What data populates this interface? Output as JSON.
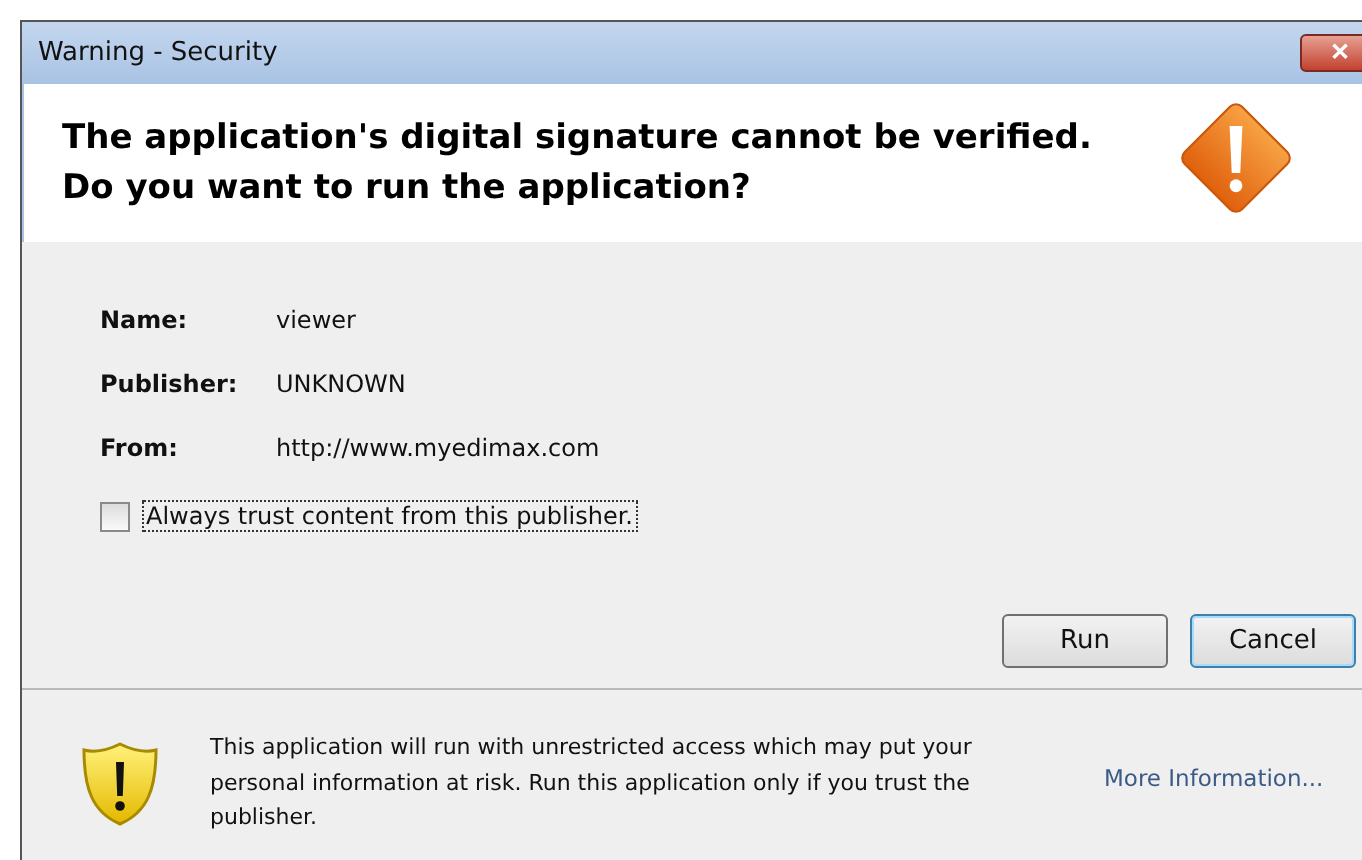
{
  "window": {
    "title": "Warning - Security",
    "close": "✕"
  },
  "heading": [
    "The application's digital signature cannot be verified.",
    "Do you want to run the application?"
  ],
  "details": [
    {
      "label": "Name:",
      "value": "viewer"
    },
    {
      "label": "Publisher:",
      "value": "UNKNOWN"
    },
    {
      "label": "From:",
      "value": "http://www.myedimax.com"
    }
  ],
  "trust_checkbox": {
    "label": "Always trust content from this publisher.",
    "checked": false
  },
  "buttons": [
    {
      "label": "Run",
      "default": false
    },
    {
      "label": "Cancel",
      "default": true
    }
  ],
  "footer": {
    "message": "This application will run with unrestricted access which may put your personal information at risk. Run this application only if you trust the publisher.",
    "link": "More Information..."
  }
}
